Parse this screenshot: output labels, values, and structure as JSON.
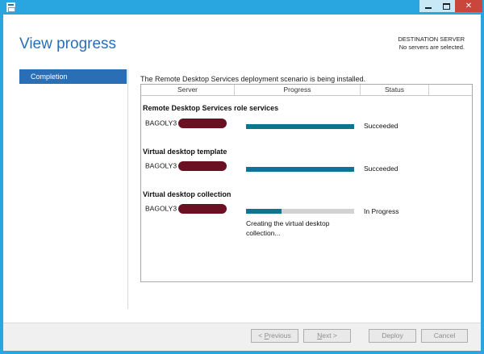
{
  "window": {
    "title_icon": "server-manager-icon",
    "controls": {
      "minimize": "minimize-icon",
      "maximize": "maximize-icon",
      "close": "close-icon"
    }
  },
  "page": {
    "title": "View progress",
    "destination_label": "DESTINATION SERVER",
    "destination_value": "No servers are selected."
  },
  "nav": {
    "items": [
      {
        "label": "Completion",
        "selected": true
      }
    ]
  },
  "main": {
    "status_message": "The Remote Desktop Services deployment scenario is being installed.",
    "columns": [
      "Server",
      "Progress",
      "Status"
    ],
    "sections": [
      {
        "title": "Remote Desktop Services role services",
        "server": "BAGOLY3",
        "progress": 1.0,
        "status": "Succeeded",
        "note": ""
      },
      {
        "title": "Virtual desktop template",
        "server": "BAGOLY3",
        "progress": 1.0,
        "status": "Succeeded",
        "note": ""
      },
      {
        "title": "Virtual desktop collection",
        "server": "BAGOLY3",
        "progress": 0.33,
        "status": "In Progress",
        "note": "Creating the virtual desktop collection..."
      }
    ]
  },
  "footer": {
    "previous": {
      "prefix": "< ",
      "accel": "P",
      "rest": "revious"
    },
    "next": {
      "accel": "N",
      "rest": "ext >"
    },
    "deploy": "Deploy",
    "cancel": "Cancel"
  },
  "colors": {
    "titlebar": "#29a6e0",
    "accent": "#2a6fb6",
    "progress_fill": "#0f7494",
    "progress_track": "#d2d2d2",
    "redaction": "#6b0f23",
    "close_button": "#c8463c"
  }
}
